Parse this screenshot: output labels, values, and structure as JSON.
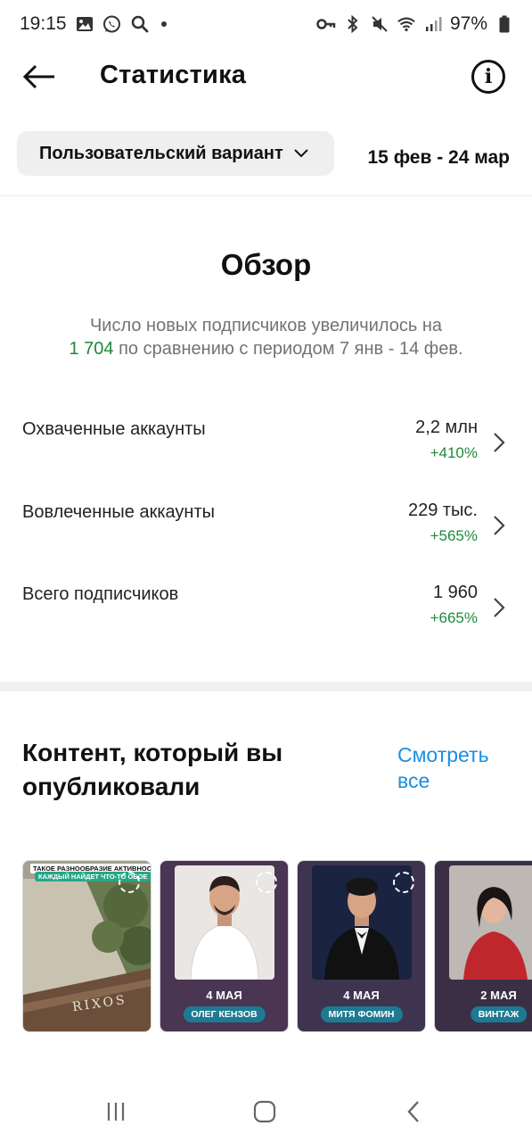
{
  "status_bar": {
    "time": "19:15",
    "battery": "97%"
  },
  "app_bar": {
    "title": "Статистика"
  },
  "filters": {
    "dropdown_label": "Пользовательский вариант",
    "date_range": "15 фев - 24 мар"
  },
  "overview": {
    "title": "Обзор",
    "subtitle_line1": "Число новых подписчиков увеличилось на",
    "subtitle_number": "1 704",
    "subtitle_line2": "по сравнению с периодом 7 янв - 14 фев.",
    "metrics": [
      {
        "label": "Охваченные аккаунты",
        "value": "2,2 млн",
        "change": "+410%"
      },
      {
        "label": "Вовлеченные аккаунты",
        "value": "229 тыс.",
        "change": "+565%"
      },
      {
        "label": "Всего подписчиков",
        "value": "1 960",
        "change": "+665%"
      }
    ]
  },
  "content": {
    "title": "Контент, который вы опубликовали",
    "see_all": "Смотреть все",
    "posts": [
      {
        "banner1": "ТАКОЕ РАЗНООБРАЗИЕ АКТИВНОСТЕЙ",
        "banner2": "КАЖДЫЙ НАЙДЕТ ЧТО-ТО ОБОЕ",
        "logo": "RIXOS"
      },
      {
        "date": "4 МАЯ",
        "tag": "ОЛЕГ КЕНЗОВ"
      },
      {
        "date": "4 МАЯ",
        "tag": "МИТЯ ФОМИН"
      },
      {
        "date": "2 МАЯ",
        "tag": "ВИНТАЖ"
      }
    ]
  },
  "colors": {
    "accent_link": "#1a8fe3",
    "positive": "#1f8a3b",
    "muted_text": "#737373"
  }
}
